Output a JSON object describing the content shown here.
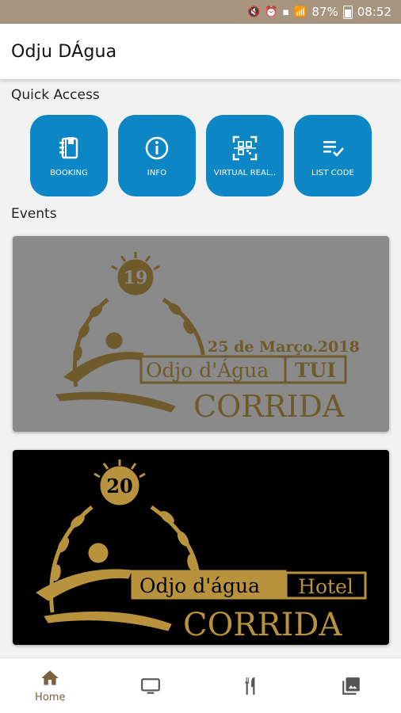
{
  "status_bar": {
    "battery_percent": "87%",
    "time": "08:52"
  },
  "app_bar": {
    "title": "Odju DÁgua"
  },
  "quick_access": {
    "heading": "Quick Access",
    "items": [
      {
        "label": "BOOKING",
        "icon": "booking-book-icon"
      },
      {
        "label": "INFO",
        "icon": "info-icon"
      },
      {
        "label": "VIRTUAL REAL..",
        "icon": "qr-scan-icon"
      },
      {
        "label": "LIST CODE",
        "icon": "list-check-icon"
      }
    ]
  },
  "events": {
    "heading": "Events",
    "cards": [
      {
        "badge_number": "19",
        "date": "25 de Março.2018",
        "brand": "Odjo d'Água",
        "tag": "TUI",
        "event_name": "CORRIDA",
        "background": "#8a8a8a",
        "ink": "#6f5a2c"
      },
      {
        "badge_number": "20",
        "brand": "Odjo d'água",
        "tag": "Hotel",
        "event_name": "CORRIDA",
        "background": "#000000",
        "ink": "#b8923c"
      }
    ]
  },
  "bottom_nav": {
    "items": [
      {
        "label": "Home",
        "icon": "home-icon",
        "active": true
      },
      {
        "icon": "tv-icon"
      },
      {
        "icon": "restaurant-icon"
      },
      {
        "icon": "gallery-icon"
      }
    ]
  },
  "colors": {
    "accent": "#0d86c6",
    "status_bar": "#a89580",
    "nav_active": "#7a6140",
    "nav_inactive": "#555555"
  }
}
